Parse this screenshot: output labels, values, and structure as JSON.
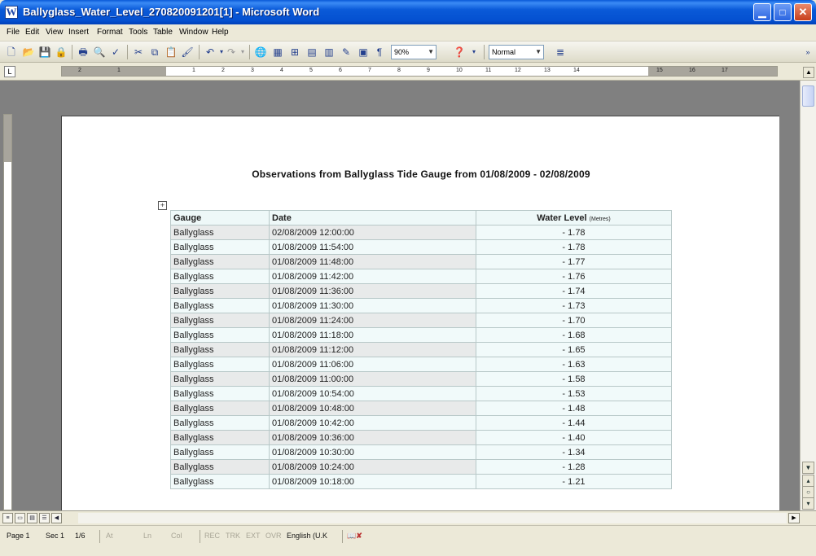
{
  "window": {
    "title": "Ballyglass_Water_Level_270820091201[1] - Microsoft Word",
    "app_icon_letter": "W"
  },
  "menu": {
    "items": [
      "File",
      "Edit",
      "View",
      "Insert",
      "Format",
      "Tools",
      "Table",
      "Window",
      "Help"
    ]
  },
  "toolbar": {
    "zoom": "90%",
    "style": "Normal",
    "pilcrow": "¶"
  },
  "ruler": {
    "left_numbers": [
      "2",
      "1"
    ],
    "right_numbers": [
      "1",
      "2",
      "3",
      "4",
      "5",
      "6",
      "7",
      "8",
      "9",
      "10",
      "11",
      "12",
      "13",
      "14",
      "15",
      "16",
      "17"
    ]
  },
  "document": {
    "title": "Observations from Ballyglass Tide Gauge from 01/08/2009 - 02/08/2009",
    "table": {
      "headers": {
        "gauge": "Gauge",
        "date": "Date",
        "level": "Water Level",
        "level_unit": "(Metres)"
      },
      "rows": [
        {
          "gauge": "Ballyglass",
          "date": "02/08/2009 12:00:00",
          "level": "- 1.78"
        },
        {
          "gauge": "Ballyglass",
          "date": "01/08/2009 11:54:00",
          "level": "- 1.78"
        },
        {
          "gauge": "Ballyglass",
          "date": "01/08/2009 11:48:00",
          "level": "- 1.77"
        },
        {
          "gauge": "Ballyglass",
          "date": "01/08/2009 11:42:00",
          "level": "- 1.76"
        },
        {
          "gauge": "Ballyglass",
          "date": "01/08/2009 11:36:00",
          "level": "- 1.74"
        },
        {
          "gauge": "Ballyglass",
          "date": "01/08/2009 11:30:00",
          "level": "- 1.73"
        },
        {
          "gauge": "Ballyglass",
          "date": "01/08/2009 11:24:00",
          "level": "- 1.70"
        },
        {
          "gauge": "Ballyglass",
          "date": "01/08/2009 11:18:00",
          "level": "- 1.68"
        },
        {
          "gauge": "Ballyglass",
          "date": "01/08/2009 11:12:00",
          "level": "- 1.65"
        },
        {
          "gauge": "Ballyglass",
          "date": "01/08/2009 11:06:00",
          "level": "- 1.63"
        },
        {
          "gauge": "Ballyglass",
          "date": "01/08/2009 11:00:00",
          "level": "- 1.58"
        },
        {
          "gauge": "Ballyglass",
          "date": "01/08/2009 10:54:00",
          "level": "- 1.53"
        },
        {
          "gauge": "Ballyglass",
          "date": "01/08/2009 10:48:00",
          "level": "- 1.48"
        },
        {
          "gauge": "Ballyglass",
          "date": "01/08/2009 10:42:00",
          "level": "- 1.44"
        },
        {
          "gauge": "Ballyglass",
          "date": "01/08/2009 10:36:00",
          "level": "- 1.40"
        },
        {
          "gauge": "Ballyglass",
          "date": "01/08/2009 10:30:00",
          "level": "- 1.34"
        },
        {
          "gauge": "Ballyglass",
          "date": "01/08/2009 10:24:00",
          "level": "- 1.28"
        },
        {
          "gauge": "Ballyglass",
          "date": "01/08/2009 10:18:00",
          "level": "- 1.21"
        }
      ]
    }
  },
  "status": {
    "page": "Page 1",
    "section": "Sec 1",
    "page_of": "1/6",
    "at": "At",
    "ln": "Ln",
    "col": "Col",
    "rec": "REC",
    "trk": "TRK",
    "ext": "EXT",
    "ovr": "OVR",
    "language": "English (U.K"
  }
}
